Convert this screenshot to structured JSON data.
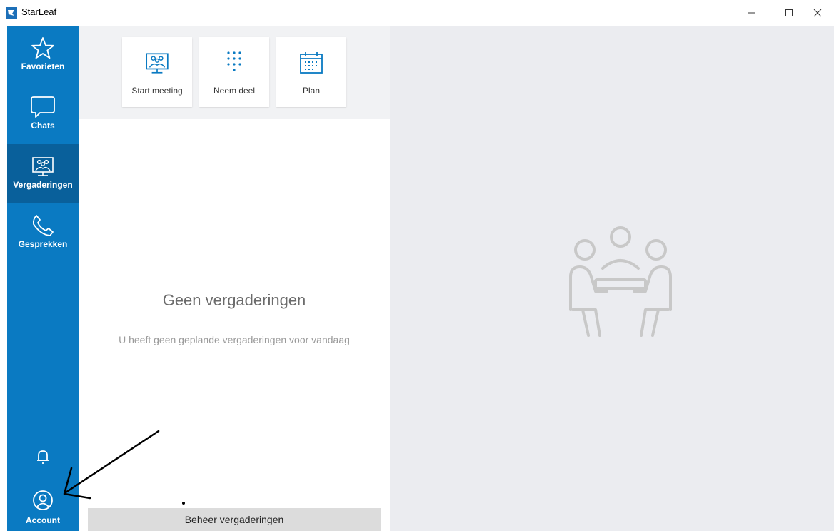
{
  "window": {
    "title": "StarLeaf"
  },
  "sidebar": {
    "items": [
      {
        "label": "Favorieten",
        "icon": "star-icon"
      },
      {
        "label": "Chats",
        "icon": "chat-bubble-icon"
      },
      {
        "label": "Vergaderingen",
        "icon": "meeting-icon",
        "active": true
      },
      {
        "label": "Gesprekken",
        "icon": "phone-icon"
      }
    ],
    "bell_icon": "bell-icon",
    "account": {
      "label": "Account",
      "icon": "user-circle-icon"
    }
  },
  "actions": [
    {
      "label": "Start meeting",
      "icon": "meeting-icon"
    },
    {
      "label": "Neem deel",
      "icon": "dialpad-icon"
    },
    {
      "label": "Plan",
      "icon": "calendar-icon"
    }
  ],
  "empty_state": {
    "title": "Geen vergaderingen",
    "subtitle": "U heeft geen geplande vergaderingen voor vandaag"
  },
  "manage_button": {
    "label": "Beheer vergaderingen"
  },
  "colors": {
    "sidebar": "#0a7ac2",
    "sidebar_active": "#09609b",
    "accent": "#0a7ac2",
    "right_panel": "#ebecf0"
  }
}
